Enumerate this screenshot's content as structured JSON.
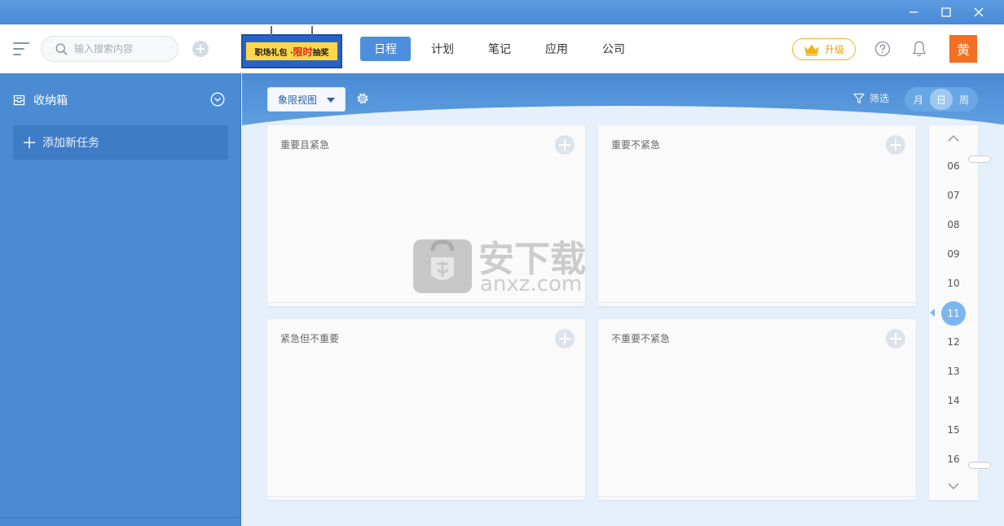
{
  "window": {
    "controls": [
      "minimize",
      "maximize",
      "close"
    ]
  },
  "header": {
    "search_placeholder": "输入搜索内容",
    "banner": {
      "text_a": "职场礼包 · ",
      "text_hl": "限时",
      "text_b": "抽奖"
    },
    "tabs": [
      {
        "label": "日程",
        "active": true
      },
      {
        "label": "计划",
        "active": false
      },
      {
        "label": "笔记",
        "active": false
      },
      {
        "label": "应用",
        "active": false
      },
      {
        "label": "公司",
        "active": false
      }
    ],
    "upgrade_label": "升级",
    "avatar_text": "黄"
  },
  "sidebar": {
    "inbox_label": "收纳箱",
    "add_task_label": "添加新任务"
  },
  "main": {
    "view_select": "象限视图",
    "filter_label": "筛选",
    "segments": [
      {
        "label": "月",
        "active": false
      },
      {
        "label": "日",
        "active": true
      },
      {
        "label": "周",
        "active": false
      }
    ],
    "quadrants": [
      {
        "title": "重要且紧急"
      },
      {
        "title": "重要不紧急"
      },
      {
        "title": "紧急但不重要"
      },
      {
        "title": "不重要不紧急"
      }
    ],
    "timeline": {
      "hours": [
        "06",
        "07",
        "08",
        "09",
        "10",
        "11",
        "12",
        "13",
        "14",
        "15",
        "16"
      ],
      "current": "11"
    },
    "watermark": {
      "text": "安下载",
      "sub": "anxz.com"
    }
  },
  "colors": {
    "accent": "#4d8fdc",
    "sidebar": "#4a8bd4",
    "upgrade": "#f0b32a",
    "avatar": "#f36f21"
  }
}
